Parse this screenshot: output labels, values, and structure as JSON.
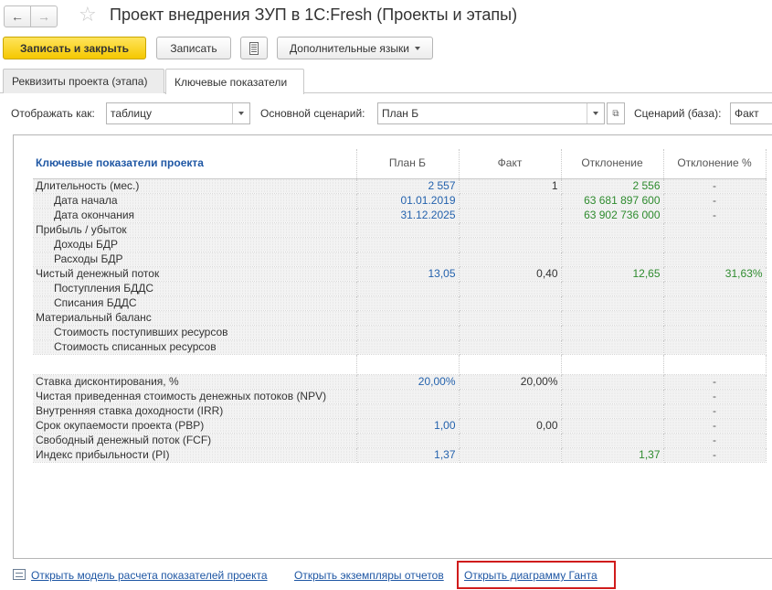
{
  "window": {
    "title": "Проект внедрения ЗУП в 1С:Fresh (Проекты и этапы)"
  },
  "toolbar": {
    "save_close_label": "Записать и закрыть",
    "save_label": "Записать",
    "languages_label": "Дополнительные языки"
  },
  "tabs": [
    {
      "label": "Реквизиты проекта (этапа)",
      "active": false
    },
    {
      "label": "Ключевые показатели",
      "active": true
    }
  ],
  "filters": {
    "display_label": "Отображать как:",
    "display_value": "таблицу",
    "main_scenario_label": "Основной сценарий:",
    "main_scenario_value": "План Б",
    "base_scenario_label": "Сценарий (база):",
    "base_scenario_value": "Факт"
  },
  "table": {
    "headers": [
      "Ключевые показатели проекта",
      "План Б",
      "Факт",
      "Отклонение",
      "Отклонение %"
    ],
    "rows": [
      {
        "label": "Длительность (мес.)",
        "indent": false,
        "plan": "2 557",
        "fact": "1",
        "dev": "2 556",
        "devp": "-"
      },
      {
        "label": "Дата начала",
        "indent": true,
        "plan": "01.01.2019",
        "fact": "",
        "dev": "63 681 897 600",
        "devp": "-"
      },
      {
        "label": "Дата окончания",
        "indent": true,
        "plan": "31.12.2025",
        "fact": "",
        "dev": "63 902 736 000",
        "devp": "-"
      },
      {
        "label": "Прибыль / убыток",
        "indent": false,
        "plan": "",
        "fact": "",
        "dev": "",
        "devp": ""
      },
      {
        "label": "Доходы БДР",
        "indent": true,
        "plan": "",
        "fact": "",
        "dev": "",
        "devp": ""
      },
      {
        "label": "Расходы БДР",
        "indent": true,
        "plan": "",
        "fact": "",
        "dev": "",
        "devp": ""
      },
      {
        "label": "Чистый денежный поток",
        "indent": false,
        "plan": "13,05",
        "fact": "0,40",
        "dev": "12,65",
        "devp": "31,63%"
      },
      {
        "label": "Поступления БДДС",
        "indent": true,
        "plan": "",
        "fact": "",
        "dev": "",
        "devp": ""
      },
      {
        "label": "Списания БДДС",
        "indent": true,
        "plan": "",
        "fact": "",
        "dev": "",
        "devp": ""
      },
      {
        "label": "Материальный баланс",
        "indent": false,
        "plan": "",
        "fact": "",
        "dev": "",
        "devp": ""
      },
      {
        "label": "Стоимость поступивших ресурсов",
        "indent": true,
        "plan": "",
        "fact": "",
        "dev": "",
        "devp": ""
      },
      {
        "label": "Стоимость списанных ресурсов",
        "indent": true,
        "plan": "",
        "fact": "",
        "dev": "",
        "devp": ""
      }
    ],
    "rows2": [
      {
        "label": "Ставка дисконтирования, %",
        "plan": "20,00%",
        "fact": "20,00%",
        "dev": "",
        "devp": "-"
      },
      {
        "label": "Чистая приведенная стоимость денежных потоков (NPV)",
        "plan": "",
        "fact": "",
        "dev": "",
        "devp": "-"
      },
      {
        "label": "Внутренняя ставка доходности (IRR)",
        "plan": "",
        "fact": "",
        "dev": "",
        "devp": "-"
      },
      {
        "label": "Срок окупаемости проекта (PBP)",
        "plan": "1,00",
        "fact": "0,00",
        "dev": "",
        "devp": "-"
      },
      {
        "label": "Свободный денежный поток (FCF)",
        "plan": "",
        "fact": "",
        "dev": "",
        "devp": "-"
      },
      {
        "label": "Индекс прибыльности (PI)",
        "plan": "1,37",
        "fact": "",
        "dev": "1,37",
        "devp": "-"
      }
    ]
  },
  "footer": {
    "link_model": "Открыть модель расчета показателей проекта",
    "link_reports": "Открыть экземпляры отчетов",
    "link_gantt": "Открыть диаграмму Ганта"
  },
  "colors": {
    "accent_yellow": "#f5c800",
    "link_blue": "#1f57a4",
    "plan_blue": "#2462ad",
    "dev_green": "#2e8b2e",
    "highlight_red": "#d01c1c"
  }
}
